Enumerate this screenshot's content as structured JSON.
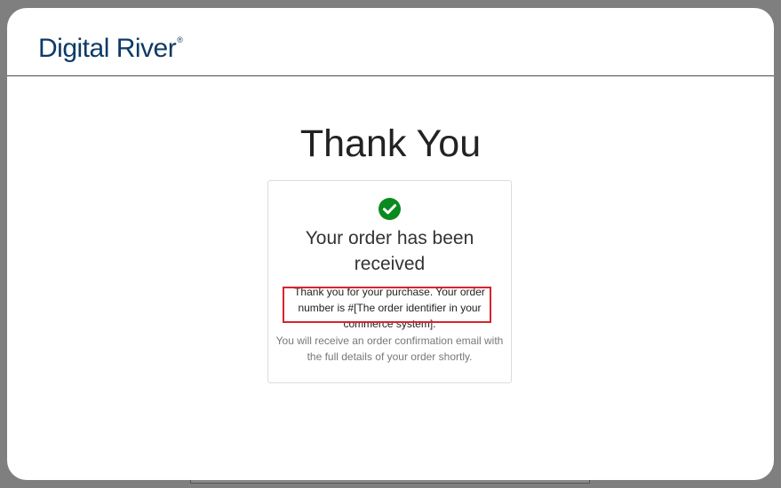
{
  "header": {
    "logo_text": "Digital River",
    "logo_mark": "®"
  },
  "main": {
    "title": "Thank You",
    "card": {
      "icon": "check-circle-icon",
      "heading": "Your order has been received",
      "message": "Thank you for your purchase. Your order number is #[The order identifier in your commerce system].",
      "note": "You will receive an order confirmation email with the full details of your order shortly."
    }
  },
  "colors": {
    "brand": "#0d3b66",
    "success": "#0a8a1e",
    "highlight": "#d9232e"
  }
}
